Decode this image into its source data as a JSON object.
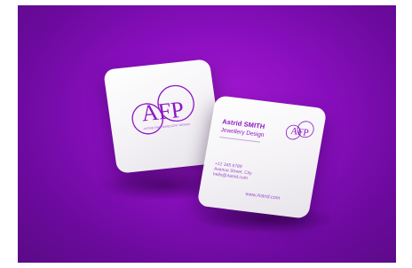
{
  "scene": {
    "background_color": "#8a0fbf",
    "card_color": "#ffffff",
    "accent_color": "#8d16c4"
  },
  "front_card": {
    "logo_letters": "AFP",
    "logo_tagline": "ASTRID FINE JEWELLERY DESIGN"
  },
  "back_card": {
    "logo_letters": "AFP",
    "name": "Astrid SMITH",
    "role": "Jewellery Design",
    "phone": "+12 345 6789",
    "address": "Avenue Street, City",
    "email": "hello@Astrid.com",
    "website": "www.Astrid.com"
  }
}
